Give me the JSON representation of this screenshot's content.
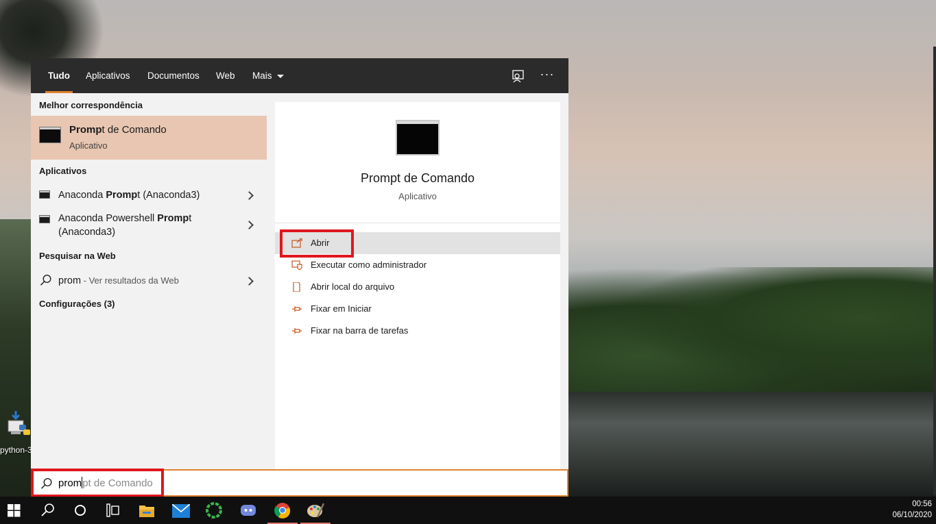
{
  "desktop": {
    "icon_label": "python-3"
  },
  "search": {
    "tabs": [
      {
        "label": "Tudo",
        "active": true
      },
      {
        "label": "Aplicativos",
        "active": false
      },
      {
        "label": "Documentos",
        "active": false
      },
      {
        "label": "Web",
        "active": false
      },
      {
        "label": "Mais",
        "active": false
      }
    ],
    "feedback_icon": "feedback-icon",
    "more_icon": "ellipsis-icon",
    "query_typed": "prom",
    "query_suggestion": "pt de Comando"
  },
  "results": {
    "best_match_header": "Melhor correspondência",
    "best_match": {
      "title_bold": "Promp",
      "title_rest": "t de Comando",
      "subtitle": "Aplicativo",
      "icon": "command-prompt-icon"
    },
    "apps_header": "Aplicativos",
    "apps": [
      {
        "pre": "Anaconda ",
        "bold": "Promp",
        "post": "t (Anaconda3)",
        "line2": ""
      },
      {
        "pre": "Anaconda Powershell ",
        "bold": "Promp",
        "post": "t",
        "line2": "(Anaconda3)"
      }
    ],
    "web_header": "Pesquisar na Web",
    "web": {
      "term": "prom",
      "hint": " - Ver resultados da Web"
    },
    "settings_header": "Configurações (3)"
  },
  "preview": {
    "title": "Prompt de Comando",
    "subtitle": "Aplicativo",
    "actions": [
      {
        "label": "Abrir",
        "icon": "open-icon"
      },
      {
        "label": "Executar como administrador",
        "icon": "shield-icon"
      },
      {
        "label": "Abrir local do arquivo",
        "icon": "file-location-icon"
      },
      {
        "label": "Fixar em Iniciar",
        "icon": "pin-icon"
      },
      {
        "label": "Fixar na barra de tarefas",
        "icon": "pin-icon"
      }
    ]
  },
  "taskbar": {
    "time": "00:56",
    "date": "06/10/2020",
    "items": [
      "windows-start-icon",
      "search-icon",
      "cortana-icon",
      "task-view-icon",
      "file-explorer-icon",
      "mail-icon",
      "app-ring-icon",
      "discord-icon",
      "chrome-icon",
      "paint-icon"
    ]
  },
  "colors": {
    "accent": "#e0832d",
    "highlight": "#e0161d",
    "best_match_bg": "#e8c6b1",
    "topbar_bg": "#2b2b2b"
  }
}
